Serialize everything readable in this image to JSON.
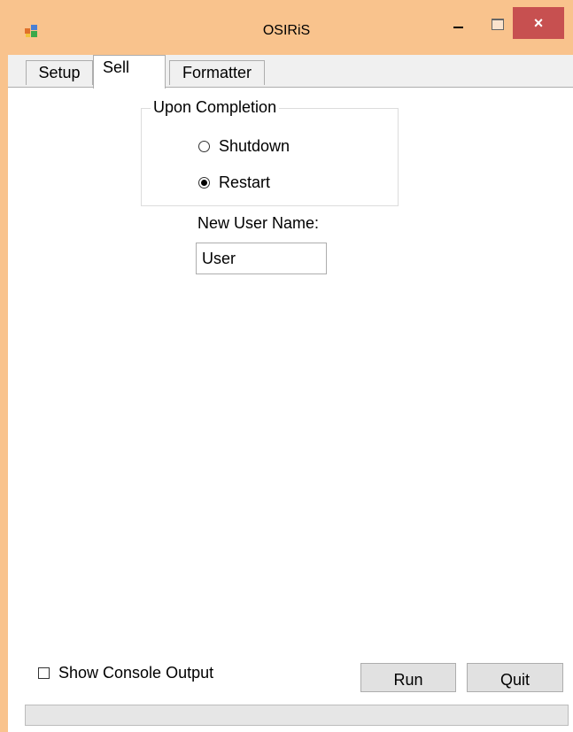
{
  "window": {
    "title": "OSIRiS",
    "icon": "app-window-icon",
    "controls": {
      "minimize_icon": "minimize-icon",
      "maximize_icon": "maximize-icon",
      "close_label": "×"
    }
  },
  "tabs": [
    {
      "label": "Setup",
      "selected": false
    },
    {
      "label": "Sell",
      "selected": true
    },
    {
      "label": "Formatter",
      "selected": false
    }
  ],
  "completion_group": {
    "legend": "Upon Completion",
    "options": [
      {
        "label": "Shutdown",
        "checked": false
      },
      {
        "label": "Restart",
        "checked": true
      }
    ]
  },
  "new_user": {
    "label": "New User Name:",
    "value": "User"
  },
  "footer": {
    "show_console_label": "Show Console Output",
    "show_console_checked": false,
    "run_label": "Run",
    "quit_label": "Quit",
    "progress": 0
  },
  "colors": {
    "titlebar": "#f9c38d",
    "close_button": "#c75050"
  }
}
